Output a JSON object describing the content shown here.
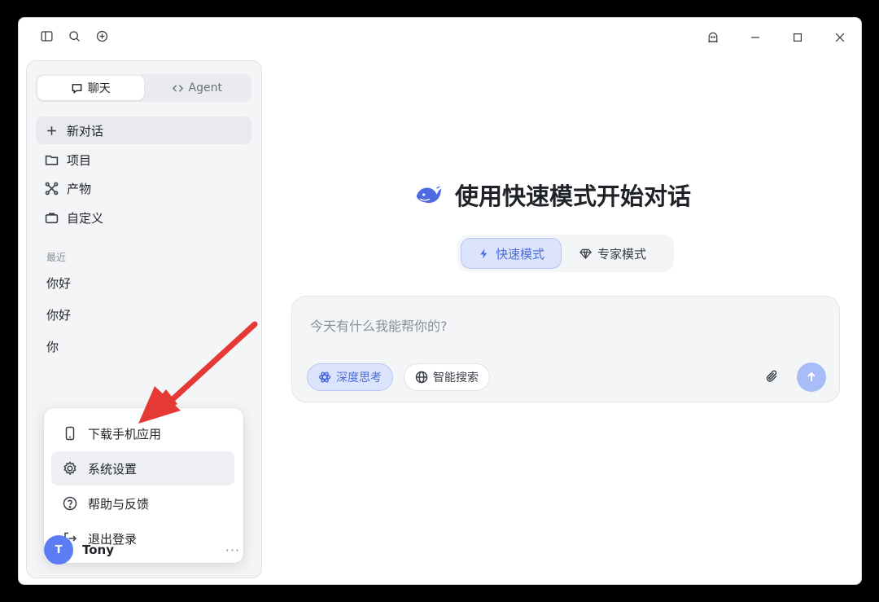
{
  "sidebar": {
    "tabs": [
      {
        "label": "聊天",
        "icon": "chat-bubble-icon",
        "active": true
      },
      {
        "label": "Agent",
        "icon": "code-brackets-icon",
        "active": false
      }
    ],
    "nav": [
      {
        "label": "新对话",
        "icon": "plus-icon"
      },
      {
        "label": "项目",
        "icon": "folder-icon"
      },
      {
        "label": "产物",
        "icon": "nodes-icon"
      },
      {
        "label": "自定义",
        "icon": "briefcase-icon"
      }
    ],
    "recent_label": "最近",
    "recent": [
      "你好",
      "你好",
      "你"
    ]
  },
  "popup": {
    "items": [
      {
        "label": "下载手机应用",
        "icon": "phone-icon"
      },
      {
        "label": "系统设置",
        "icon": "gear-icon"
      },
      {
        "label": "帮助与反馈",
        "icon": "help-circle-icon"
      },
      {
        "label": "退出登录",
        "icon": "logout-icon"
      }
    ]
  },
  "user": {
    "initial": "T",
    "name": "Tony",
    "more": "···"
  },
  "main": {
    "title": "使用快速模式开始对话",
    "modes": [
      {
        "label": "快速模式",
        "icon": "lightning-icon",
        "active": true
      },
      {
        "label": "专家模式",
        "icon": "diamond-icon",
        "active": false
      }
    ],
    "input_placeholder": "今天有什么我能帮你的?",
    "chips": [
      {
        "label": "深度思考",
        "icon": "atom-icon",
        "active": true
      },
      {
        "label": "智能搜索",
        "icon": "globe-icon",
        "active": false
      }
    ]
  },
  "colors": {
    "accent": "#4d6bde",
    "accent_bg": "#dbe4fb",
    "send_button": "#a8bdf7",
    "avatar": "#5b7cf2",
    "arrow": "#e53935"
  }
}
